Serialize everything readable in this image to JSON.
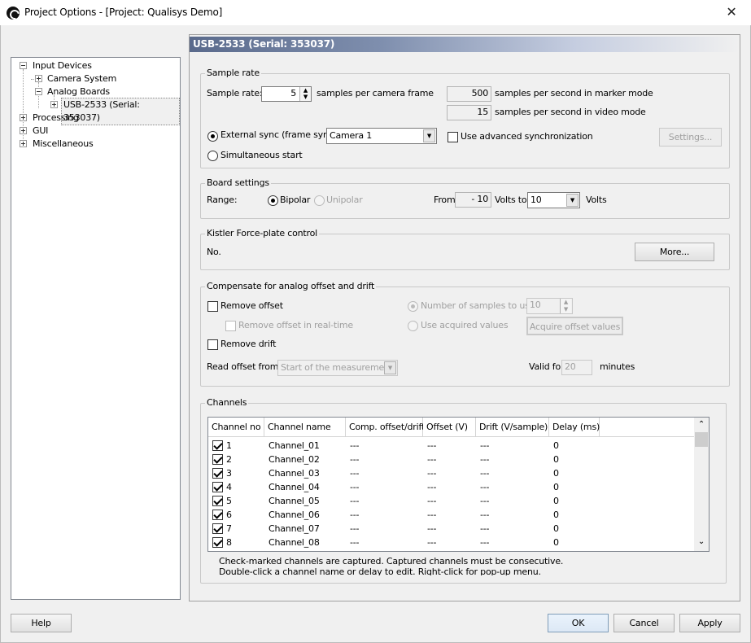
{
  "window": {
    "title": "Project Options - [Project: Qualisys Demo]",
    "close": "✕"
  },
  "tree": {
    "input_devices": "Input Devices",
    "camera_system": "Camera System",
    "analog_boards": "Analog Boards",
    "usb_board": "USB-2533 (Serial: 353037)",
    "processing": "Processing",
    "gui": "GUI",
    "misc": "Miscellaneous"
  },
  "header": "USB-2533 (Serial: 353037)",
  "sample_rate": {
    "group": "Sample rate",
    "label": "Sample rate:",
    "value": "5",
    "unit": "samples per camera frame",
    "marker_value": "500",
    "marker_text": "samples per second in marker mode",
    "video_value": "15",
    "video_text": "samples per second in video mode",
    "ext_sync": "External sync (frame sync)",
    "camera": "Camera 1",
    "advanced": "Use advanced synchronization",
    "settings_btn": "Settings...",
    "simultaneous": "Simultaneous start"
  },
  "board": {
    "group": "Board settings",
    "range": "Range:",
    "bipolar": "Bipolar",
    "unipolar": "Unipolar",
    "from": "From",
    "from_val": "- 10",
    "volts_to": "Volts to",
    "to_val": "10",
    "volts": "Volts"
  },
  "kistler": {
    "group": "Kistler Force-plate control",
    "status": "No.",
    "more": "More..."
  },
  "compensate": {
    "group": "Compensate for analog offset and drift",
    "remove_offset": "Remove offset",
    "remove_rt": "Remove offset in real-time",
    "remove_drift": "Remove drift",
    "num_samples": "Number of samples to use:",
    "num_val": "10",
    "use_acquired": "Use acquired values",
    "acquire_btn": "Acquire offset values",
    "read_from": "Read offset from",
    "read_val": "Start of the measurement",
    "valid_for": "Valid for",
    "valid_val": "20",
    "minutes": "minutes"
  },
  "channels": {
    "group": "Channels",
    "headers": [
      "Channel no",
      "Channel name",
      "Comp. offset/drift",
      "Offset (V)",
      "Drift (V/sample)",
      "Delay (ms)"
    ],
    "rows": [
      {
        "no": "1",
        "name": "Channel_01",
        "comp": "---",
        "offset": "---",
        "drift": "---",
        "delay": "0"
      },
      {
        "no": "2",
        "name": "Channel_02",
        "comp": "---",
        "offset": "---",
        "drift": "---",
        "delay": "0"
      },
      {
        "no": "3",
        "name": "Channel_03",
        "comp": "---",
        "offset": "---",
        "drift": "---",
        "delay": "0"
      },
      {
        "no": "4",
        "name": "Channel_04",
        "comp": "---",
        "offset": "---",
        "drift": "---",
        "delay": "0"
      },
      {
        "no": "5",
        "name": "Channel_05",
        "comp": "---",
        "offset": "---",
        "drift": "---",
        "delay": "0"
      },
      {
        "no": "6",
        "name": "Channel_06",
        "comp": "---",
        "offset": "---",
        "drift": "---",
        "delay": "0"
      },
      {
        "no": "7",
        "name": "Channel_07",
        "comp": "---",
        "offset": "---",
        "drift": "---",
        "delay": "0"
      },
      {
        "no": "8",
        "name": "Channel_08",
        "comp": "---",
        "offset": "---",
        "drift": "---",
        "delay": "0"
      }
    ],
    "note1": "Check-marked channels are captured. Captured channels must be consecutive.",
    "note2": "Double-click a channel name or delay to edit. Right-click for pop-up menu."
  },
  "buttons": {
    "help": "Help",
    "ok": "OK",
    "cancel": "Cancel",
    "apply": "Apply"
  }
}
